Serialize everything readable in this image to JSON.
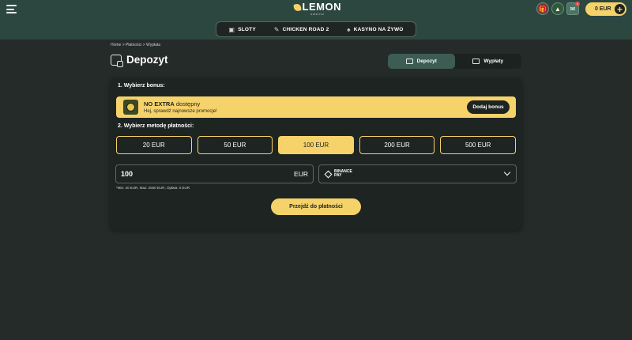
{
  "header": {
    "logo_text": "LEMON",
    "logo_sub": "casino",
    "balance": "0 EUR",
    "mail_badge": "1",
    "icons": [
      "menu-icon",
      "gift-icon",
      "tree-icon",
      "mail-icon",
      "plus-icon"
    ]
  },
  "nav": {
    "items": [
      {
        "label": "SLOTY",
        "icon": "slot-icon"
      },
      {
        "label": "CHICKEN ROAD 2",
        "icon": "chicken-icon"
      },
      {
        "label": "KASYNO NA ŻYWO",
        "icon": "cards-icon"
      }
    ]
  },
  "breadcrumb": "Home > Płatności > Wypłata",
  "page": {
    "title": "Depozyt",
    "tabs": [
      {
        "label": "Depozyt",
        "active": true
      },
      {
        "label": "Wypłaty",
        "active": false
      }
    ]
  },
  "form": {
    "step1": "1. Wybierz bonus:",
    "bonus": {
      "name": "NO EXTRA",
      "status": "dostępny",
      "subtitle": "Hej, sprawdź najnowsze promocje!",
      "button": "Dodaj bonus"
    },
    "step2": "2. Wybierz metodę płatności:",
    "amounts": [
      "20 EUR",
      "50 EUR",
      "100 EUR",
      "200 EUR",
      "500 EUR"
    ],
    "selected_amount": "100 EUR",
    "amount_value": "100",
    "currency": "EUR",
    "method_line1": "BINANCE",
    "method_line2": "PAY",
    "limits": "*Min: 20 EUR, Max: 2500 EUR, Opłata: 0 EUR",
    "submit": "Przejdź do płatności"
  },
  "colors": {
    "accent": "#f5d26a",
    "topbar": "#2c4740",
    "background": "#252b29",
    "card": "#1e2422"
  }
}
